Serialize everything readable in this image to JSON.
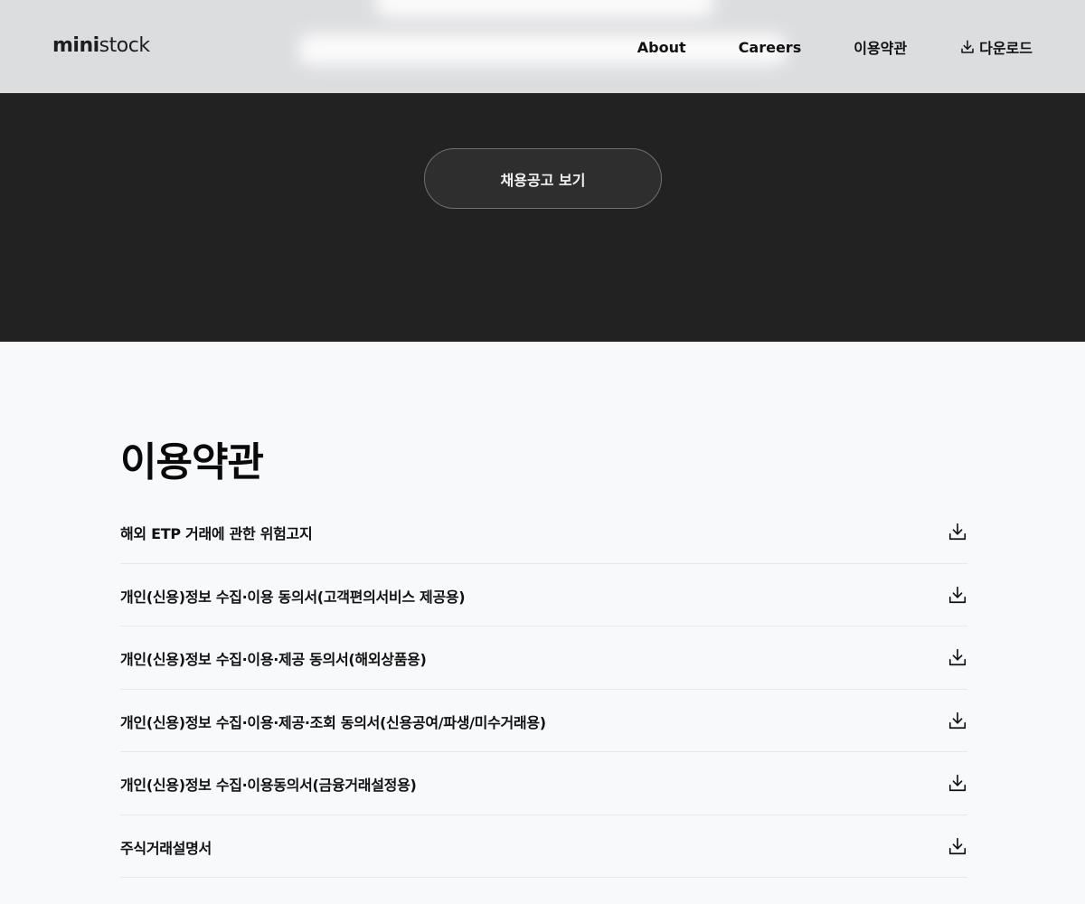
{
  "header": {
    "logo_bold": "mini",
    "logo_light": "stock",
    "nav": [
      {
        "label": "About"
      },
      {
        "label": "Careers"
      },
      {
        "label": "이용약관"
      },
      {
        "label": "다운로드",
        "icon": "download-icon"
      }
    ]
  },
  "hero": {
    "cta_label": "채용공고 보기"
  },
  "terms": {
    "title": "이용약관",
    "items": [
      {
        "label": "해외 ETP 거래에 관한 위험고지",
        "icon": "download-icon"
      },
      {
        "label": "개인(신용)정보 수집·이용 동의서(고객편의서비스 제공용)",
        "icon": "download-icon"
      },
      {
        "label": "개인(신용)정보 수집·이용·제공 동의서(해외상품용)",
        "icon": "download-icon"
      },
      {
        "label": "개인(신용)정보 수집·이용·제공·조회 동의서(신용공여/파생/미수거래용)",
        "icon": "download-icon"
      },
      {
        "label": "개인(신용)정보 수집·이용동의서(금융거래설정용)",
        "icon": "download-icon"
      },
      {
        "label": "주식거래설명서",
        "icon": "download-icon"
      }
    ]
  },
  "colors": {
    "header_bg": "#dcdddf",
    "hero_bg": "#222222",
    "page_bg": "#f8f9fb",
    "button_border": "#6f6f6f"
  }
}
